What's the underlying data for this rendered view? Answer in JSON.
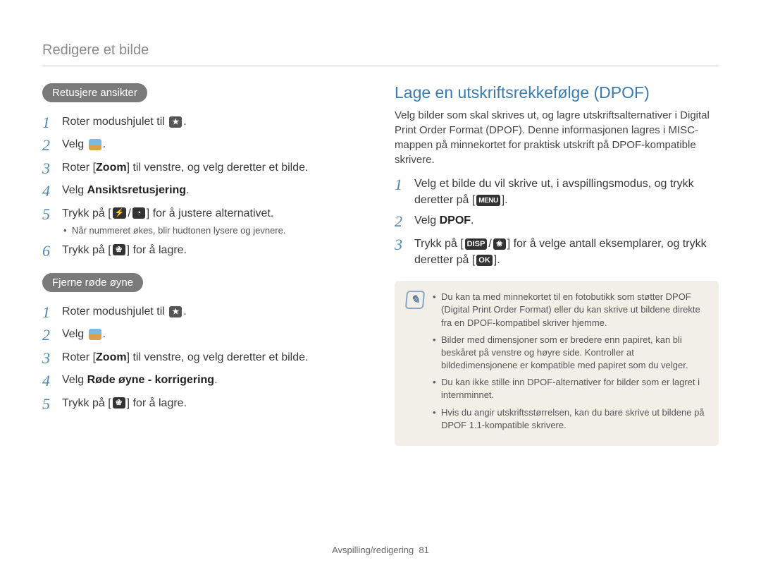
{
  "breadcrumb": "Redigere et bilde",
  "left": {
    "pill1": "Retusjere ansikter",
    "steps1": [
      {
        "n": "1",
        "html": "Roter modushjulet til {star}."
      },
      {
        "n": "2",
        "html": "Velg {photo}."
      },
      {
        "n": "3",
        "html": "Roter [<b>Zoom</b>] til venstre, og velg deretter et bilde."
      },
      {
        "n": "4",
        "html": "Velg <b>Ansiktsretusjering</b>."
      },
      {
        "n": "5",
        "html": "Trykk på [{flash}/{timer}] for å justere alternativet.",
        "sub": "Når nummeret økes, blir hudtonen lysere og jevnere."
      },
      {
        "n": "6",
        "html": "Trykk på [{flower}] for å lagre."
      }
    ],
    "pill2": "Fjerne røde øyne",
    "steps2": [
      {
        "n": "1",
        "html": "Roter modushjulet til {star}."
      },
      {
        "n": "2",
        "html": "Velg {photo}."
      },
      {
        "n": "3",
        "html": "Roter [<b>Zoom</b>] til venstre, og velg deretter et bilde."
      },
      {
        "n": "4",
        "html": "Velg <b>Røde øyne - korrigering</b>."
      },
      {
        "n": "5",
        "html": "Trykk på [{flower}] for å lagre."
      }
    ]
  },
  "right": {
    "heading": "Lage en utskriftsrekkefølge (DPOF)",
    "intro": "Velg bilder som skal skrives ut, og lagre utskriftsalternativer i Digital Print Order Format (DPOF). Denne informasjonen lagres i MISC-mappen på minnekortet for praktisk utskrift på DPOF-kompatible skrivere.",
    "steps": [
      {
        "n": "1",
        "html": "Velg et bilde du vil skrive ut, i avspillingsmodus, og trykk deretter på [{MENU}]."
      },
      {
        "n": "2",
        "html": "Velg <b>DPOF</b>."
      },
      {
        "n": "3",
        "html": "Trykk på [{DISP}/{flower}] for å velge antall eksemplarer, og trykk deretter på [{OK}]."
      }
    ],
    "notes": [
      "Du kan ta med minnekortet til en fotobutikk som støtter DPOF (Digital Print Order Format) eller du kan skrive ut bildene direkte fra en DPOF-kompatibel skriver hjemme.",
      "Bilder med dimensjoner som er bredere enn papiret, kan bli beskåret på venstre og høyre side. Kontroller at bildedimensjonene er kompatible med papiret som du velger.",
      "Du kan ikke stille inn DPOF-alternativer for bilder som er lagret i internminnet.",
      "Hvis du angir utskriftsstørrelsen, kan du bare skrive ut bildene på DPOF 1.1-kompatible skrivere."
    ]
  },
  "footer": {
    "section": "Avspilling/redigering",
    "page": "81"
  },
  "icons": {
    "star": "★",
    "flash": "⚡",
    "timer": "◔",
    "flower": "❀",
    "MENU": "MENU",
    "DISP": "DISP",
    "OK": "OK"
  }
}
